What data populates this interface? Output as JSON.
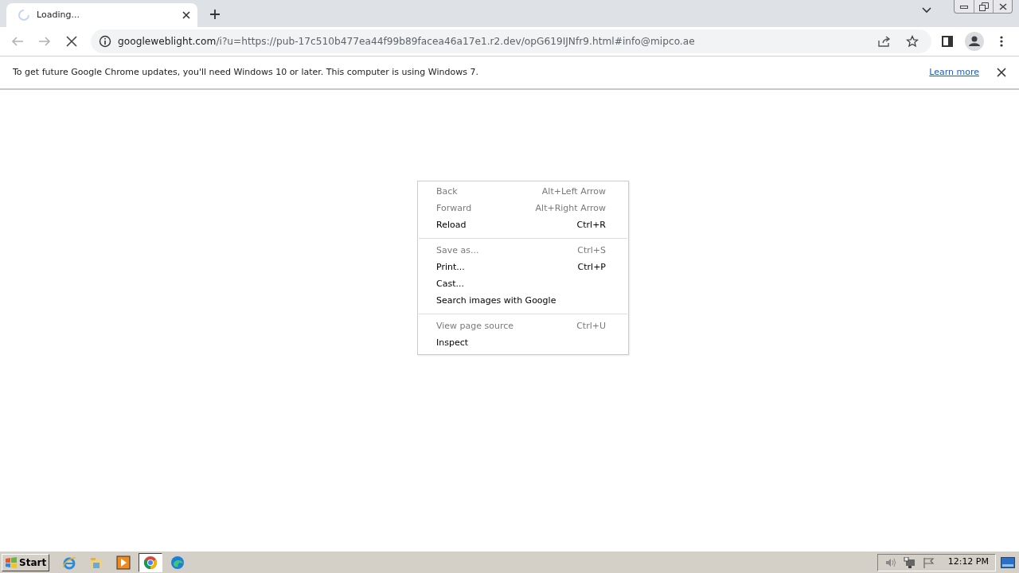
{
  "tab": {
    "title": "Loading...",
    "loading": true
  },
  "address": {
    "host": "googleweblight.com",
    "path": "/i?u=https://pub-17c510b477ea44f99b89facea46a17e1.r2.dev/opG619IJNfr9.html#info@mipco.ae"
  },
  "nav": {
    "back_disabled": true,
    "forward_disabled": true
  },
  "infobar": {
    "message": "To get future Google Chrome updates, you'll need Windows 10 or later. This computer is using Windows 7.",
    "link": "Learn more"
  },
  "context_menu": {
    "groups": [
      [
        {
          "label": "Back",
          "shortcut": "Alt+Left Arrow",
          "disabled": true
        },
        {
          "label": "Forward",
          "shortcut": "Alt+Right Arrow",
          "disabled": true
        },
        {
          "label": "Reload",
          "shortcut": "Ctrl+R",
          "disabled": false
        }
      ],
      [
        {
          "label": "Save as...",
          "shortcut": "Ctrl+S",
          "disabled": true
        },
        {
          "label": "Print...",
          "shortcut": "Ctrl+P",
          "disabled": false
        },
        {
          "label": "Cast...",
          "disabled": false
        },
        {
          "label": "Search images with Google",
          "disabled": false
        }
      ],
      [
        {
          "label": "View page source",
          "shortcut": "Ctrl+U",
          "disabled": true
        },
        {
          "label": "Inspect",
          "disabled": false
        }
      ]
    ]
  },
  "taskbar": {
    "start": "Start",
    "items": [
      {
        "kind": "ie",
        "selected": false
      },
      {
        "kind": "explorer",
        "selected": false
      },
      {
        "kind": "media",
        "selected": false
      },
      {
        "kind": "chrome",
        "selected": true
      },
      {
        "kind": "edge",
        "selected": false
      }
    ],
    "clock": "12:12 PM"
  }
}
